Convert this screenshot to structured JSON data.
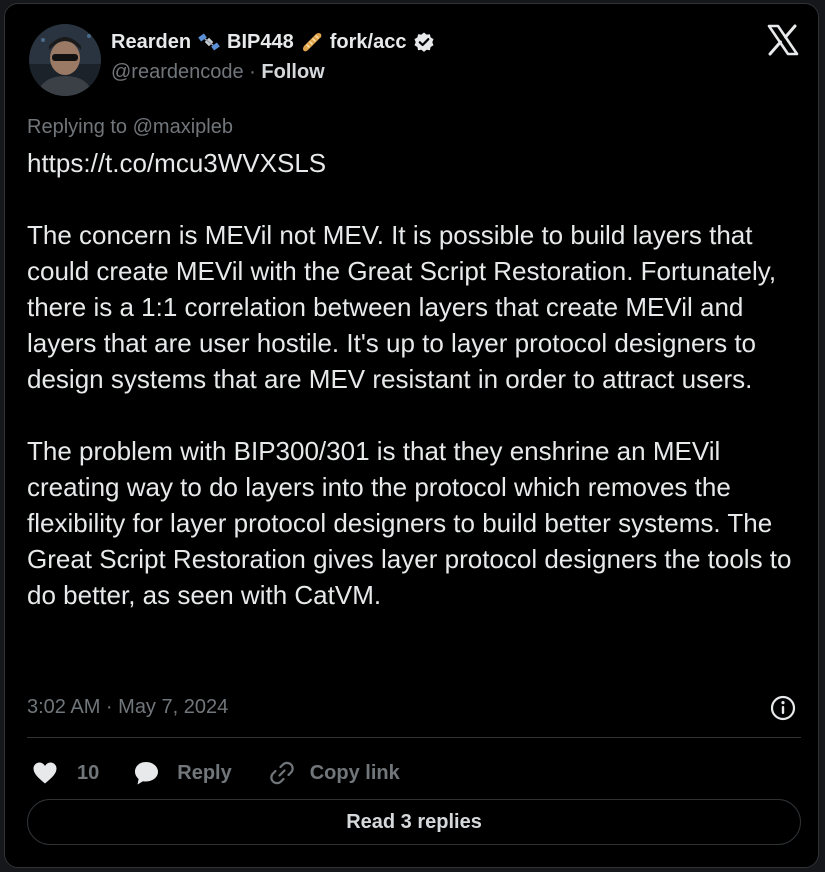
{
  "author": {
    "name": "Rearden",
    "name_part2": "BIP448",
    "name_part3": "fork/acc",
    "handle": "@reardencode",
    "separator": " · ",
    "follow_label": "Follow"
  },
  "replying_to": "Replying to @maxipleb",
  "tweet": {
    "text": "https://t.co/mcu3WVXSLS\n\nThe concern is MEVil not MEV. It is possible to build layers that could create MEVil with the Great Script Restoration. Fortunately, there is a 1:1 correlation between layers that create MEVil and layers that are user hostile. It's up to layer protocol designers to design systems that are MEV resistant in order to attract users.\n\nThe problem with BIP300/301 is that they enshrine an MEVil creating way to do layers into the protocol which removes the flexibility for layer protocol designers to build better systems. The Great Script Restoration gives layer protocol designers the tools to do better, as seen with CatVM.",
    "timestamp": "3:02 AM · May 7, 2024"
  },
  "actions": {
    "like_count": "10",
    "reply_label": "Reply",
    "copy_link_label": "Copy link"
  },
  "read_replies_label": "Read 3 replies",
  "icons": {
    "emoji_1": "satellite-icon",
    "emoji_2": "baguette-icon",
    "verified": "verified-badge-icon",
    "logo": "x-logo-icon",
    "info": "info-icon",
    "like": "heart-icon",
    "reply": "speech-bubble-icon",
    "copy": "link-icon"
  },
  "colors": {
    "background": "#000000",
    "text_primary": "#e7e9ea",
    "text_secondary": "#71767b",
    "border": "#2f3336"
  }
}
